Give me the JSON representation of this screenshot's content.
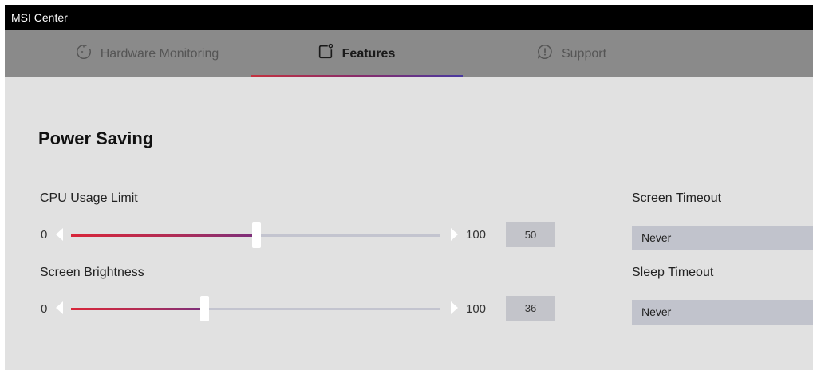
{
  "window": {
    "title": "MSI Center"
  },
  "tabs": [
    {
      "label": "Hardware Monitoring",
      "icon": "timer-icon",
      "active": false
    },
    {
      "label": "Features",
      "icon": "features-icon",
      "active": true
    },
    {
      "label": "Support",
      "icon": "support-icon",
      "active": false
    }
  ],
  "section": {
    "title": "Power Saving"
  },
  "sliders": [
    {
      "label": "CPU Usage Limit",
      "min_label": "0",
      "max_label": "100",
      "value": "50",
      "fraction": 0.5
    },
    {
      "label": "Screen Brightness",
      "min_label": "0",
      "max_label": "100",
      "value": "36",
      "fraction": 0.36
    }
  ],
  "dropdowns": [
    {
      "label": "Screen Timeout",
      "value": "Never"
    },
    {
      "label": "Sleep Timeout",
      "value": "Never"
    }
  ],
  "colors": {
    "titlebar": "#000000",
    "tabbar": "#8a8a8a",
    "background": "#e1e1e1",
    "accent_red": "#d8263a",
    "accent_purple": "#4a3aa0"
  }
}
